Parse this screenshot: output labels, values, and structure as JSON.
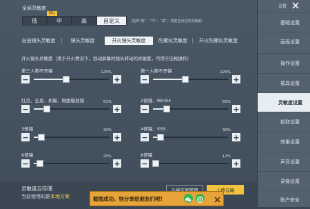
{
  "side": {
    "title": "设置",
    "items": [
      {
        "label": "基础设置",
        "active": false
      },
      {
        "label": "画面设置",
        "active": false
      },
      {
        "label": "操作设置",
        "active": false
      },
      {
        "label": "载具设置",
        "active": false
      },
      {
        "label": "灵敏度设置",
        "active": true
      },
      {
        "label": "拾取设置",
        "active": false
      },
      {
        "label": "效果设置",
        "active": false
      },
      {
        "label": "声音设置",
        "active": false
      },
      {
        "label": "录像设置",
        "active": false
      },
      {
        "label": "账户安全",
        "active": false
      }
    ]
  },
  "global": {
    "title": "全局灵敏度",
    "presets": [
      "低",
      "中",
      "高",
      "自定义"
    ],
    "active_preset": "自定义",
    "badge": "默认",
    "hint": "（选择“低”、“中”、“高”，恢复至对应的灵敏度）"
  },
  "tabs": [
    "自由镜头灵敏度",
    "镜头灵敏度",
    "开火镜头灵敏度",
    "陀螺仪灵敏度",
    "开火陀螺仪灵敏度"
  ],
  "active_tab": "开火镜头灵敏度",
  "description": "开火镜头灵敏度（用于开火情况下，划动屏幕时镜头转动的灵敏度，可用于压枪操作）",
  "sliders": [
    {
      "label": "第三人称不开镜",
      "value_text": "125%",
      "level": 0.43
    },
    {
      "label": "第一人称不开镜",
      "value_text": "125%",
      "level": 0.43
    },
    {
      "label": "红点、全息、机瞄、侧面瞄准镜",
      "value_text": "51%",
      "level": 0.17
    },
    {
      "label": "2倍镜、Win94",
      "value_text": "55%",
      "level": 0.18
    },
    {
      "label": "3倍镜",
      "value_text": "30%",
      "level": 0.1
    },
    {
      "label": "4倍镜、VSS",
      "value_text": "30%",
      "level": 0.1
    },
    {
      "label": "6倍镜",
      "value_text": "25%",
      "level": 0.08
    },
    {
      "label": "8倍镜",
      "value_text": "12%",
      "level": 0.04
    }
  ],
  "cloud": {
    "title": "灵敏度云存储",
    "sub_prefix": "当前使用的是",
    "sub_highlight": "本地方案",
    "btn_manage": "云端方案管理",
    "btn_upload": "上传云端"
  },
  "toast": {
    "text": "截图成功，快分享给朋友们吧!"
  },
  "colors": {
    "accent": "#f2c23f",
    "panel": "#4a5866",
    "active": "#f0f3f6"
  }
}
